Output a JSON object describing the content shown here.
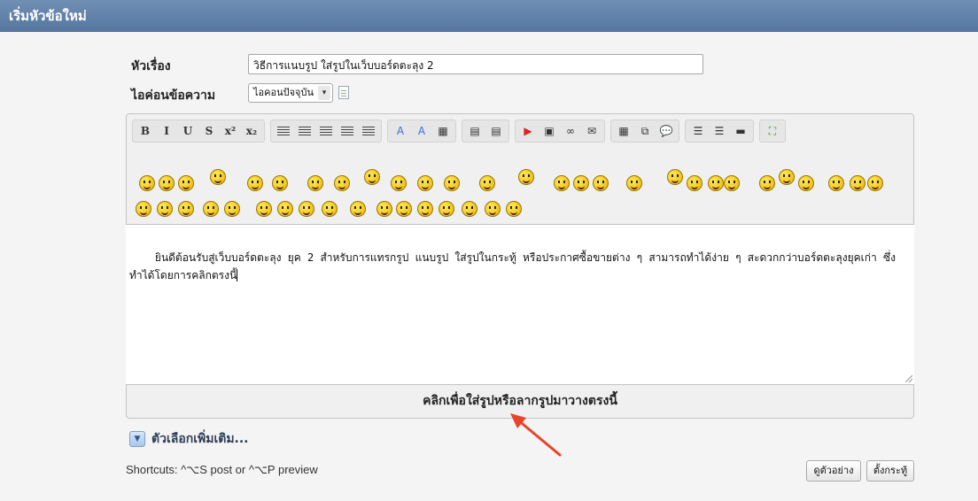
{
  "header": {
    "title": "เริ่มหัวข้อใหม่"
  },
  "form": {
    "subject_label": "หัวเรื่อง",
    "subject_value": "วิธีการแนบรูป ใส่รูปในเว็บบอร์ดตะลุง 2",
    "icon_label": "ไอค่อนข้อความ",
    "icon_select_value": "ไอคอนปัจจุบัน"
  },
  "toolbar": {
    "groups": [
      [
        {
          "name": "bold-button",
          "glyph": "B"
        },
        {
          "name": "italic-button",
          "glyph": "I"
        },
        {
          "name": "underline-button",
          "glyph": "U"
        },
        {
          "name": "strikethrough-button",
          "glyph": "S"
        },
        {
          "name": "superscript-button",
          "glyph": "x²"
        },
        {
          "name": "subscript-button",
          "glyph": "x₂"
        }
      ],
      [
        {
          "name": "align-left-button",
          "glyph": "lines"
        },
        {
          "name": "align-center-button",
          "glyph": "lines"
        },
        {
          "name": "align-right-button",
          "glyph": "lines"
        },
        {
          "name": "align-justify-button",
          "glyph": "lines"
        },
        {
          "name": "align-full-button",
          "glyph": "lines"
        }
      ],
      [
        {
          "name": "font-color-button",
          "glyph": "A"
        },
        {
          "name": "remove-format-button",
          "glyph": "A"
        },
        {
          "name": "color-grid-button",
          "glyph": "▦"
        }
      ],
      [
        {
          "name": "outdent-button",
          "glyph": "▤"
        },
        {
          "name": "indent-button",
          "glyph": "▤"
        }
      ],
      [
        {
          "name": "youtube-button",
          "glyph": "▶"
        },
        {
          "name": "insert-image-button",
          "glyph": "▣"
        },
        {
          "name": "insert-link-button",
          "glyph": "∞"
        },
        {
          "name": "insert-email-button",
          "glyph": "✉"
        }
      ],
      [
        {
          "name": "insert-table-button",
          "glyph": "▦"
        },
        {
          "name": "insert-media-button",
          "glyph": "⧉"
        },
        {
          "name": "insert-quote-button",
          "glyph": "💬"
        }
      ],
      [
        {
          "name": "bullet-list-button",
          "glyph": "☰"
        },
        {
          "name": "numbered-list-button",
          "glyph": "☰"
        },
        {
          "name": "horizontal-rule-button",
          "glyph": "▬"
        }
      ],
      [
        {
          "name": "source-mode-button",
          "glyph": "⛶"
        }
      ]
    ]
  },
  "editor": {
    "content": "ยินดีต้อนรับสู่เว็บบอร์ดตะลุง ยุค 2 สำหรับการแทรกรูป แนบรูป ใส่รูปในกระทู้ หรือประกาศซื้อขายต่าง ๆ สามารถทำได้ง่าย ๆ สะดวกกว่าบอร์ดตะลุงยุคเก่า ซึ่งทำได้โดยการคลิกตรงนี้",
    "upload_label": "คลิกเพื่อใส่รูปหรือลากรูปมาวางตรงนี้"
  },
  "options": {
    "more_label": "ตัวเลือกเพิ่มเติม..."
  },
  "footer": {
    "shortcuts": "Shortcuts: ^⌥S post or ^⌥P preview",
    "preview_label": "ดูตัวอย่าง",
    "post_label": "ตั้งกระทู้"
  },
  "colors": {
    "header": "#5e7fa8",
    "accent_arrow": "#e8442a"
  }
}
